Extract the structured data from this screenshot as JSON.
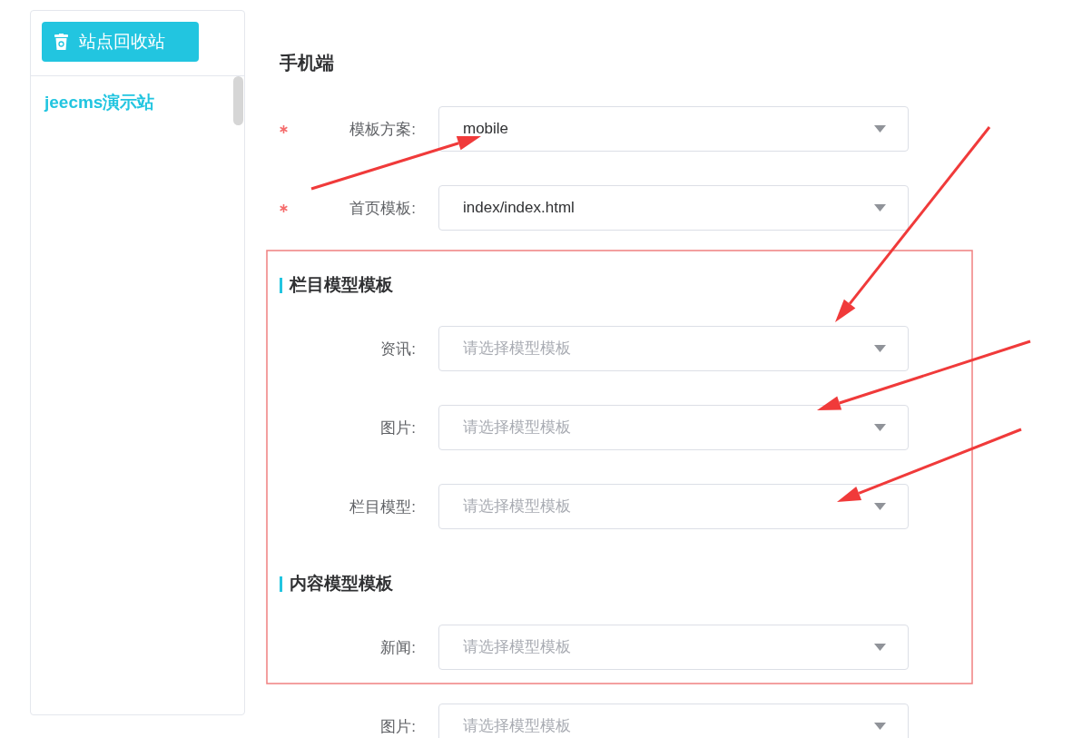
{
  "sidebar": {
    "recycle_button": "站点回收站",
    "items": [
      {
        "label": "jeecms演示站",
        "selected": true
      }
    ]
  },
  "title": "手机端",
  "fields": [
    {
      "label": "模板方案:",
      "required": true,
      "value": "mobile"
    },
    {
      "label": "首页模板:",
      "required": true,
      "value": "index/index.html"
    }
  ],
  "sections": [
    {
      "title": "栏目模型模板",
      "fields": [
        {
          "label": "资讯:",
          "required": false,
          "placeholder": "请选择模型模板"
        },
        {
          "label": "图片:",
          "required": false,
          "placeholder": "请选择模型模板"
        },
        {
          "label": "栏目模型:",
          "required": false,
          "placeholder": "请选择模型模板"
        }
      ]
    },
    {
      "title": "内容模型模板",
      "fields": [
        {
          "label": "新闻:",
          "required": false,
          "placeholder": "请选择模型模板"
        },
        {
          "label": "图片:",
          "required": false,
          "placeholder": "请选择模型模板"
        }
      ]
    }
  ]
}
